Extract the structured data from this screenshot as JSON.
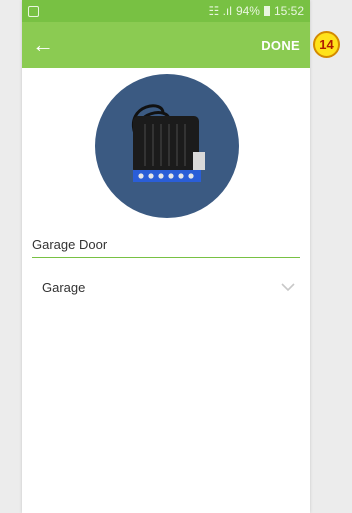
{
  "statusbar": {
    "signal": "☷ .ıl",
    "battery": "94%",
    "time": "15:52"
  },
  "appbar": {
    "back_icon": "←",
    "done_label": "DONE"
  },
  "device": {
    "image_icon": "device-module-image"
  },
  "form": {
    "name_value": "Garage Door",
    "room_value": "Garage"
  },
  "annotation": {
    "step": "14"
  },
  "colors": {
    "accent": "#8bcb52",
    "status": "#78c143",
    "avatar_bg": "#3b5a82",
    "badge": "#ffe21a"
  }
}
